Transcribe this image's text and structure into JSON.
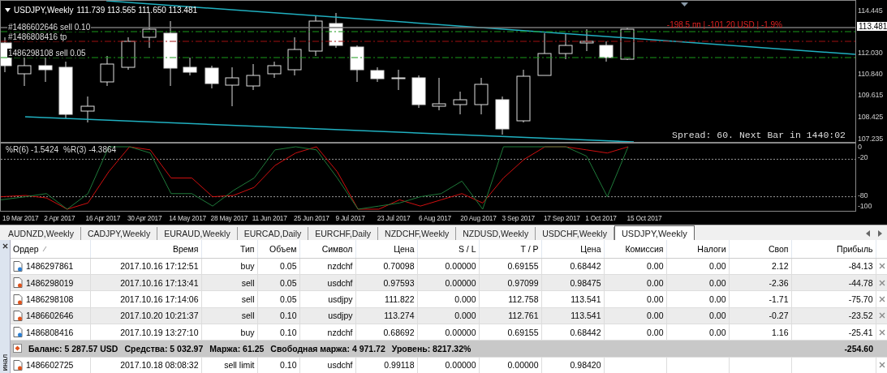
{
  "chart_window": {
    "symbol": "USDJPY,Weekly",
    "ohlc": "111.739 113.565 111.650 113.481",
    "order_labels": [
      "#1486602646 sell 0.10",
      "#1486808416 tp",
      "1486298108 sell 0.05"
    ],
    "profit_label": "-198.5 пп | -101.20 USD | -1.9%",
    "spread_text": "Spread: 60. Next Bar in 1440:02",
    "price_ticks": [
      "114.445",
      "112.030",
      "110.840",
      "109.615",
      "108.425",
      "107.235"
    ],
    "current_price": "113.481",
    "indicator": {
      "label_1": "%R(6) -1.5424",
      "label_2": "%R(3) -4.3864",
      "ticks": [
        "0",
        "-20",
        "-80",
        "-100"
      ]
    },
    "dates": [
      "19 Mar 2017",
      "2 Apr 2017",
      "16 Apr 2017",
      "30 Apr 2017",
      "14 May 2017",
      "28 May 2017",
      "11 Jun 2017",
      "25 Jun 2017",
      "9 Jul 2017",
      "23 Jul 2017",
      "6 Aug 2017",
      "20 Aug 2017",
      "3 Sep 2017",
      "17 Sep 2017",
      "1 Oct 2017",
      "15 Oct 2017"
    ]
  },
  "tabs": [
    {
      "label": "AUDNZD,Weekly",
      "selected": false
    },
    {
      "label": "CADJPY,Weekly",
      "selected": false
    },
    {
      "label": "EURAUD,Weekly",
      "selected": false
    },
    {
      "label": "EURCAD,Daily",
      "selected": false
    },
    {
      "label": "EURCHF,Daily",
      "selected": false
    },
    {
      "label": "NZDCHF,Weekly",
      "selected": false
    },
    {
      "label": "NZDUSD,Weekly",
      "selected": false
    },
    {
      "label": "USDCHF,Weekly",
      "selected": false
    },
    {
      "label": "USDJPY,Weekly",
      "selected": true
    }
  ],
  "terminal": {
    "side_label": "инал",
    "columns": [
      "Ордер",
      "Время",
      "Тип",
      "Объем",
      "Символ",
      "Цена",
      "S / L",
      "T / P",
      "Цена",
      "Комиссия",
      "Налоги",
      "Своп",
      "Прибыль"
    ],
    "rows": [
      {
        "kind": "buy",
        "cells": [
          "1486297861",
          "2017.10.16 17:12:51",
          "buy",
          "0.05",
          "nzdchf",
          "0.70098",
          "0.00000",
          "0.69155",
          "0.68442",
          "0.00",
          "0.00",
          "2.12",
          "-84.13"
        ]
      },
      {
        "kind": "sell",
        "cells": [
          "1486298019",
          "2017.10.16 17:13:41",
          "sell",
          "0.05",
          "usdchf",
          "0.97593",
          "0.00000",
          "0.97099",
          "0.98475",
          "0.00",
          "0.00",
          "-2.36",
          "-44.78"
        ]
      },
      {
        "kind": "sell",
        "cells": [
          "1486298108",
          "2017.10.16 17:14:06",
          "sell",
          "0.05",
          "usdjpy",
          "111.822",
          "0.000",
          "112.758",
          "113.541",
          "0.00",
          "0.00",
          "-1.71",
          "-75.70"
        ]
      },
      {
        "kind": "sell",
        "cells": [
          "1486602646",
          "2017.10.20 10:21:37",
          "sell",
          "0.10",
          "usdjpy",
          "113.274",
          "0.000",
          "112.761",
          "113.541",
          "0.00",
          "0.00",
          "-0.27",
          "-23.52"
        ]
      },
      {
        "kind": "buy",
        "cells": [
          "1486808416",
          "2017.10.19 13:27:10",
          "buy",
          "0.10",
          "nzdchf",
          "0.68692",
          "0.00000",
          "0.69155",
          "0.68442",
          "0.00",
          "0.00",
          "1.16",
          "-25.41"
        ]
      }
    ],
    "summary": {
      "items": [
        "Баланс: 5 287.57 USD",
        "Средства: 5 032.97",
        "Маржа: 61.25",
        "Свободная маржа: 4 971.72",
        "Уровень: 8217.32%"
      ],
      "total": "-254.60"
    },
    "pending": [
      {
        "kind": "sell",
        "cells": [
          "1486602725",
          "2017.10.18 08:08:32",
          "sell limit",
          "0.10",
          "usdchf",
          "0.99118",
          "0.00000",
          "0.00000",
          "0.98420",
          null,
          null,
          null,
          null
        ]
      }
    ]
  }
}
